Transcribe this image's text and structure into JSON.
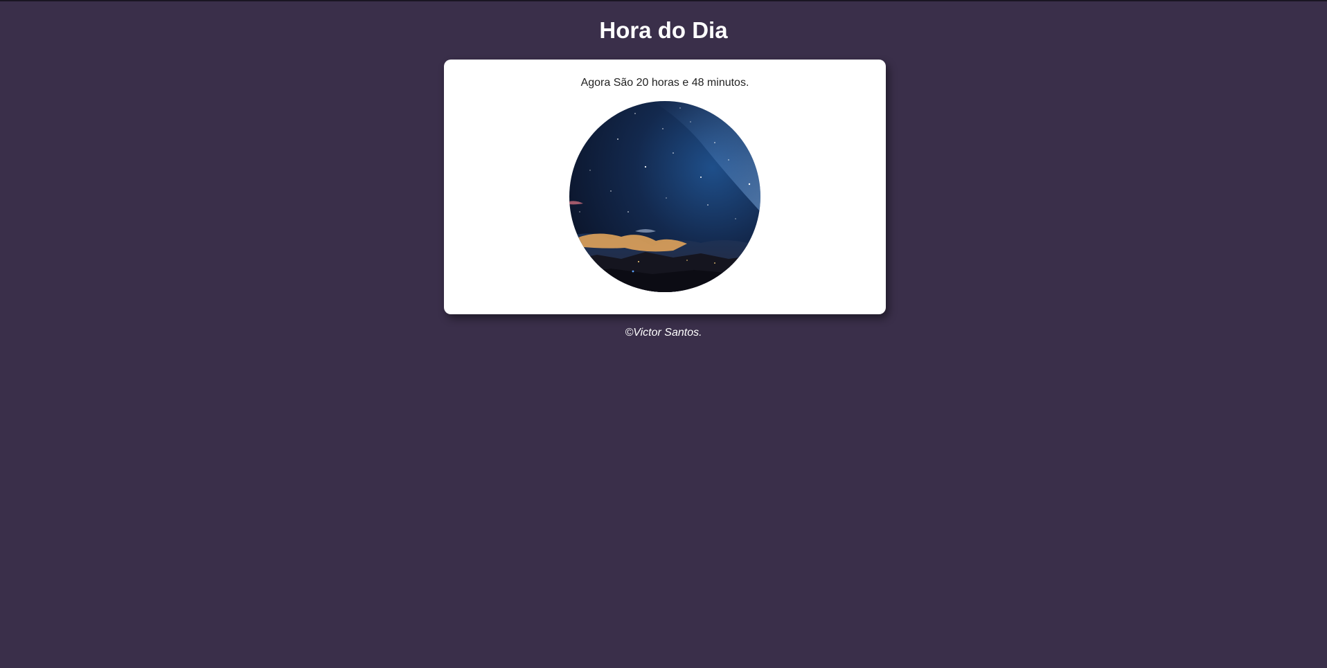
{
  "page": {
    "title": "Hora do Dia"
  },
  "card": {
    "message": "Agora São 20 horas e 48 minutos.",
    "image": "night-sky-photo"
  },
  "footer": {
    "text": "©Victor Santos."
  },
  "colors": {
    "background": "#3a2f4a",
    "card": "#ffffff",
    "title": "#ffffff",
    "footer_text": "#ffffff"
  }
}
